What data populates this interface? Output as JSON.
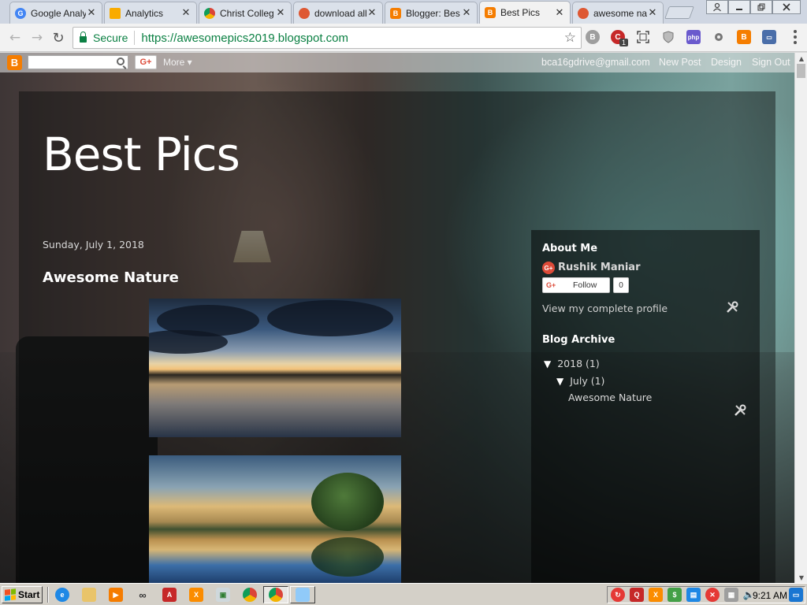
{
  "browser": {
    "tabs": [
      {
        "title": "Google Analy",
        "favicon": "google-icon",
        "color": "#4285f4",
        "active": false
      },
      {
        "title": "Analytics",
        "favicon": "analytics-icon",
        "color": "#f9ab00",
        "active": false
      },
      {
        "title": "Christ Colleg",
        "favicon": "chrome-icon",
        "color": "#db4437",
        "active": false
      },
      {
        "title": "download all",
        "favicon": "duckduckgo-icon",
        "color": "#de5833",
        "active": false
      },
      {
        "title": "Blogger: Bes",
        "favicon": "blogger-icon",
        "color": "#f57d00",
        "active": false
      },
      {
        "title": "Best Pics",
        "favicon": "blogger-icon",
        "color": "#f57d00",
        "active": true
      },
      {
        "title": "awesome na",
        "favicon": "duckduckgo-icon",
        "color": "#de5833",
        "active": false
      }
    ],
    "close_glyph": "✕",
    "address": {
      "secure_label": "Secure",
      "url_scheme": "https://",
      "url_host": "awesomepics2019.blogspot.com"
    },
    "extension_badge": "1"
  },
  "blogger_navbar": {
    "search_placeholder": "",
    "gplus_label": "G+",
    "more_label": "More ▾",
    "user_email": "bca16gdrive@gmail.com",
    "new_post": "New Post",
    "design": "Design",
    "sign_out": "Sign Out"
  },
  "blog": {
    "title": "Best Pics",
    "post": {
      "date": "Sunday, July 1, 2018",
      "title": "Awesome Nature"
    },
    "sidebar": {
      "about_heading": "About Me",
      "profile_name": "Rushik Maniar",
      "follow_label": "Follow",
      "follow_count": "0",
      "view_profile": "View my complete profile",
      "archive_heading": "Blog Archive",
      "archive_year": "2018",
      "archive_year_count": "(1)",
      "archive_month": "July",
      "archive_month_count": "(1)",
      "archive_post": "Awesome Nature"
    }
  },
  "taskbar": {
    "start_label": "Start",
    "clock": "9:21 AM"
  },
  "colors": {
    "blogger_orange": "#f57d00",
    "secure_green": "#0b8043",
    "gplus_red": "#dd4b39"
  }
}
